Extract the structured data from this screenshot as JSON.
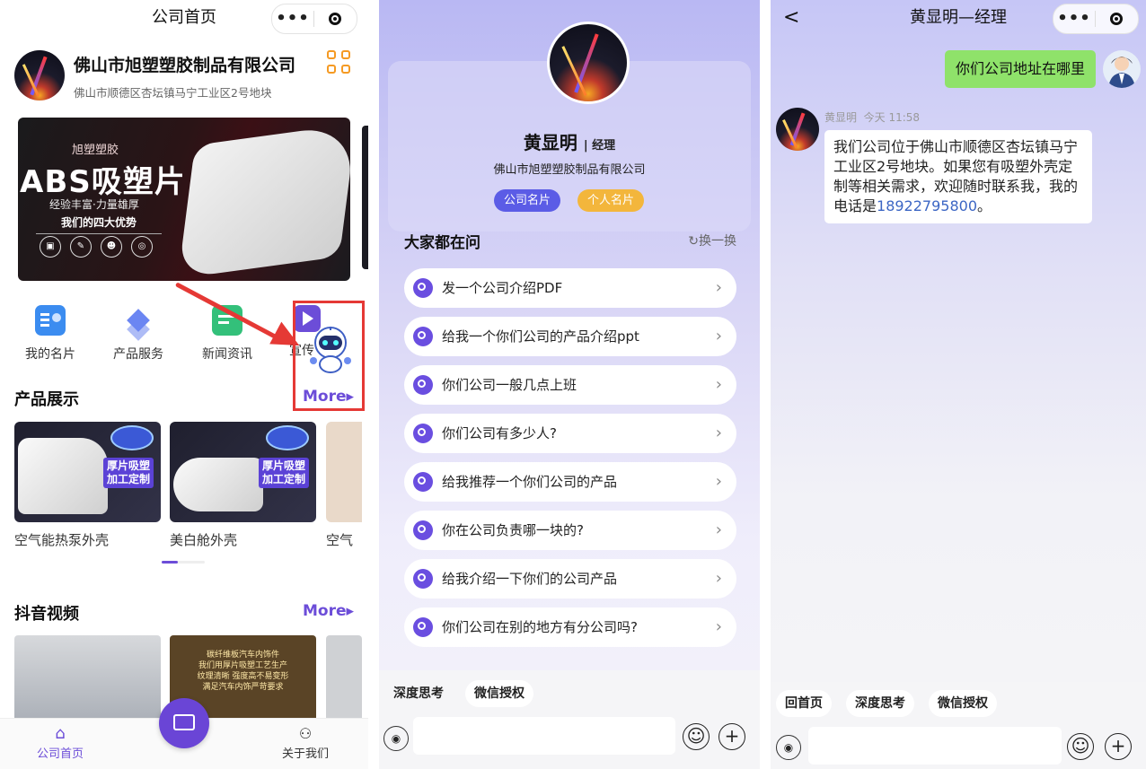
{
  "home": {
    "nav_title": "公司首页",
    "capsule_more": "•••",
    "company_name": "佛山市旭塑塑胶制品有限公司",
    "company_address": "佛山市顺德区杏坛镇马宁工业区2号地块",
    "banner": {
      "subtitle": "旭塑塑胶",
      "headline": "ABS吸塑片",
      "tagline": "经验丰富·力量雄厚",
      "advantages": "我们的四大优势"
    },
    "menu": [
      {
        "label": "我的名片",
        "icon": "card-icon",
        "color": "#3b8cf0"
      },
      {
        "label": "产品服务",
        "icon": "layers-icon",
        "color": "#6b86f2"
      },
      {
        "label": "新闻资讯",
        "icon": "news-icon",
        "color": "#33c07a"
      },
      {
        "label": "宣传",
        "icon": "video-icon",
        "color": "#6c4dd8"
      }
    ],
    "products_title": "产品展示",
    "more_label": "More▸",
    "products": [
      {
        "label": "空气能热泵外壳",
        "tag": "厚片吸塑\n加工定制"
      },
      {
        "label": "美白舱外壳",
        "tag": "厚片吸塑\n加工定制"
      },
      {
        "label": "空气"
      }
    ],
    "video_title": "抖音视频",
    "video_text": "碳纤维板汽车内饰件\n我们用厚片吸塑工艺生产\n纹理清晰 强度高不易变形\n满足汽车内饰严苛要求",
    "tabs": {
      "home": "公司首页",
      "about": "关于我们"
    },
    "accent": "#6c4dd8"
  },
  "assistant": {
    "name": "黄显明",
    "title": "经理",
    "company": "佛山市旭塑塑胶制品有限公司",
    "company_card": "公司名片",
    "personal_card": "个人名片",
    "questions_title": "大家都在问",
    "refresh": "换一换",
    "questions": [
      "发一个公司介绍PDF",
      "给我一个你们公司的产品介绍ppt",
      "你们公司一般几点上班",
      "你们公司有多少人?",
      "给我推荐一个你们公司的产品",
      "你在公司负责哪一块的?",
      "给我介绍一下你们的公司产品",
      "你们公司在别的地方有分公司吗?"
    ],
    "chips": [
      "深度思考",
      "微信授权"
    ]
  },
  "chat": {
    "nav_title": "黄显明—经理",
    "back": "<",
    "user_message": "你们公司地址在哪里",
    "agent_name": "黄显明",
    "time": "今天 11:58",
    "reply_text": "我们公司位于佛山市顺德区杏坛镇马宁工业区2号地块。如果您有吸塑外壳定制等相关需求，欢迎随时联系我，我的电话是",
    "phone": "18922795800",
    "reply_end": "。",
    "chips": [
      "回首页",
      "深度思考",
      "微信授权"
    ]
  }
}
